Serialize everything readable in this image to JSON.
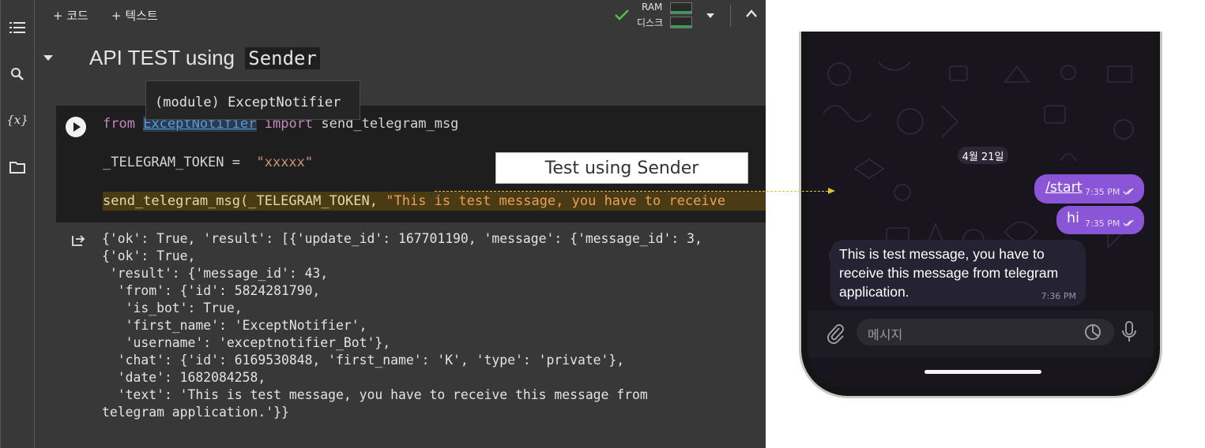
{
  "toolbar": {
    "add_code": "+ 코드",
    "add_text": "+ 텍스트",
    "ram_label": "RAM",
    "disk_label": "디스크"
  },
  "section": {
    "title": "API TEST using ",
    "title_code": "Sender"
  },
  "tooltip": "(module) ExceptNotifier",
  "code": {
    "line1": {
      "kw_from": "from",
      "module": "ExceptNotifier",
      "kw_import": "import",
      "name": "send_telegram_msg"
    },
    "line2": {
      "var": "_TELEGRAM_TOKEN = ",
      "value": "\"xxxxx\""
    },
    "line3": {
      "call": "send_telegram_msg(_TELEGRAM_TOKEN, ",
      "arg": "\"This is test message, you have to receive"
    }
  },
  "output_lines": [
    "{'ok': True, 'result': [{'update_id': 167701190, 'message': {'message_id': 3,",
    "{'ok': True,",
    " 'result': {'message_id': 43,",
    "  'from': {'id': 5824281790,",
    "   'is_bot': True,",
    "   'first_name': 'ExceptNotifier',",
    "   'username': 'exceptnotifier_Bot'},",
    "  'chat': {'id': 6169530848, 'first_name': 'K', 'type': 'private'},",
    "  'date': 1682084258,",
    "  'text': 'This is test message, you have to receive this message from",
    "telegram application.'}}"
  ],
  "annotation": "Test using Sender",
  "phone": {
    "date": "4월 21일",
    "out_messages": [
      {
        "text": "/start",
        "time": "7:35 PM"
      },
      {
        "text": "hi",
        "time": "7:35 PM"
      }
    ],
    "in_message": {
      "text": "This is test message, you have to receive this message from telegram application.",
      "time": "7:36 PM"
    },
    "input_placeholder": "메시지"
  },
  "colors": {
    "accent_purple": "#8a55d6",
    "run_check_green": "#4fc34f",
    "code_string": "#ce9178"
  },
  "icons": [
    "menu-icon",
    "search-icon",
    "variables-icon",
    "folder-icon",
    "check-icon",
    "chevron-down-icon",
    "chevron-up-icon",
    "play-icon",
    "output-icon",
    "attach-icon",
    "sticker-icon",
    "microphone-icon"
  ]
}
